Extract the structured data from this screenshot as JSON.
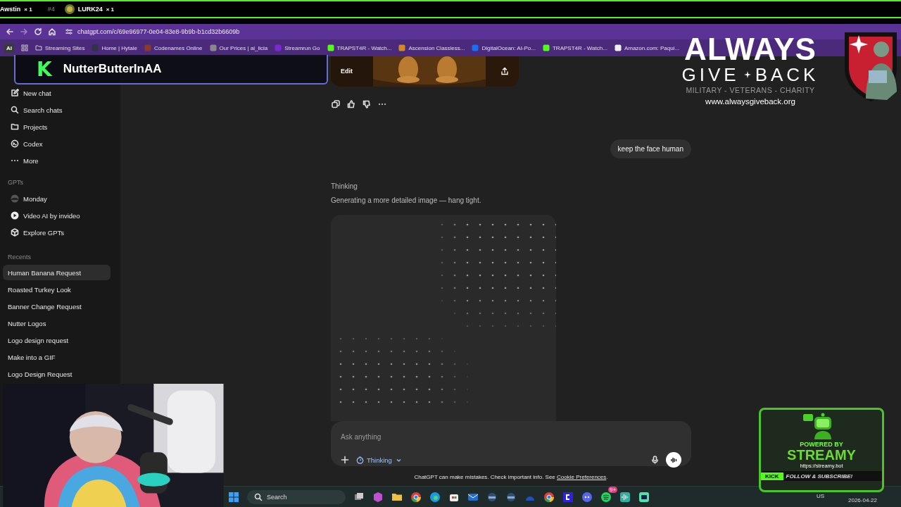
{
  "stream_bar": {
    "items": [
      {
        "kind": "name",
        "text": "Awstin",
        "count": "× 1"
      },
      {
        "kind": "rank",
        "text": "#4"
      },
      {
        "kind": "avatar_name",
        "text": "LURK24",
        "count": "× 1"
      }
    ]
  },
  "browser": {
    "url": "chatgpt.com/c/69e96977-0e04-83e8-9b9b-b1cd32b6609b",
    "bookmarks": [
      {
        "kind": "badge",
        "label": "AI"
      },
      {
        "kind": "folder",
        "label": "Streaming Sites"
      },
      {
        "kind": "site",
        "label": "Home | Hytale",
        "color": "#333344"
      },
      {
        "kind": "site",
        "label": "Codenames Online",
        "color": "#8a3a2a"
      },
      {
        "kind": "site",
        "label": "Our Prices | ai_licia",
        "color": "#888888"
      },
      {
        "kind": "site",
        "label": "Streamrun Go",
        "color": "#7a2ad0"
      },
      {
        "kind": "site",
        "label": "TRAPST4R - Watch...",
        "color": "#53fc18"
      },
      {
        "kind": "site",
        "label": "Ascension Classless...",
        "color": "#d08a20"
      },
      {
        "kind": "site",
        "label": "DigitalOcean: AI-Po...",
        "color": "#1a6ef0"
      },
      {
        "kind": "site",
        "label": "TRAPST4R - Watch...",
        "color": "#53fc18"
      },
      {
        "kind": "site",
        "label": "Amazon.com: Paqui...",
        "color": "#eeeeee"
      }
    ]
  },
  "name_overlay": {
    "badge": "K",
    "name": "NutterButterInAA"
  },
  "sidebar": {
    "nav": [
      {
        "label": "New chat"
      },
      {
        "label": "Search chats"
      },
      {
        "label": "Projects"
      },
      {
        "label": "Codex"
      },
      {
        "label": "More"
      }
    ],
    "gpts_heading": "GPTs",
    "gpts": [
      {
        "label": "Monday"
      },
      {
        "label": "Video AI by invideo"
      },
      {
        "label": "Explore GPTs"
      }
    ],
    "recents_heading": "Recents",
    "recents": [
      {
        "label": "Human Banana Request",
        "selected": true
      },
      {
        "label": "Roasted Turkey Look",
        "selected": false
      },
      {
        "label": "Banner Change Request",
        "selected": false
      },
      {
        "label": "Nutter Logos",
        "selected": false
      },
      {
        "label": "Logo design request",
        "selected": false
      },
      {
        "label": "Make into a GIF",
        "selected": false
      },
      {
        "label": "Logo Design Request",
        "selected": false
      }
    ]
  },
  "chat": {
    "image_card": {
      "button": "Edit"
    },
    "user_message": "keep the face human",
    "status": "Thinking",
    "progress_text": "Generating a more detailed image — hang tight.",
    "composer": {
      "placeholder": "Ask anything",
      "mode": "Thinking"
    },
    "disclaimer": {
      "text": "ChatGPT can make mistakes. Check important info. See ",
      "link": "Cookie Preferences",
      "end": "."
    }
  },
  "sponsor_logo": {
    "title": "ALWAYS",
    "word_left": "GIVE",
    "word_right": "BACK",
    "tagline": "MILITARY - VETERANS - CHARITY",
    "url": "www.alwaysgiveback.org"
  },
  "streamy_overlay": {
    "line1": "POWERED BY",
    "line2": "STREAMY",
    "url": "https://streamy.bot",
    "badge": "KICK",
    "cta": "FOLLOW & SUBSCRIBE!"
  },
  "taskbar": {
    "search": "Search",
    "notification_badge": "9+",
    "language": "US",
    "date": "2026-04-22"
  }
}
